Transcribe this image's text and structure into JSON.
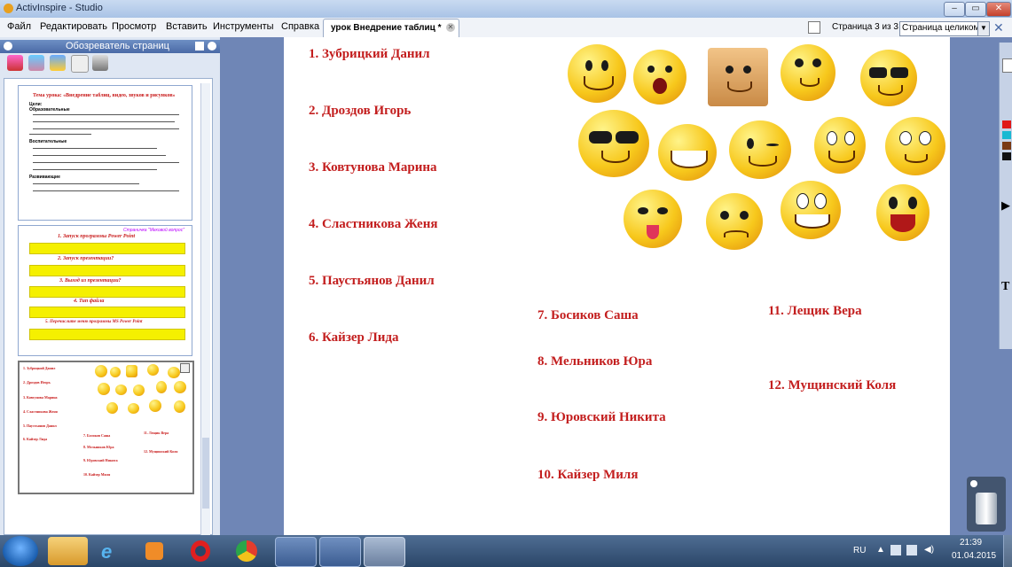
{
  "window": {
    "title": "ActivInspire - Studio"
  },
  "menu": {
    "items": [
      "Файл",
      "Редактировать",
      "Просмотр",
      "Вставить",
      "Инструменты",
      "Справка"
    ]
  },
  "document_tab": {
    "label": "урок Внедрение таблиц *"
  },
  "page_indicator": "Страница 3 из 3",
  "zoom": {
    "selected": "Страница целиком"
  },
  "page_browser": {
    "title": "Обозреватель страниц"
  },
  "thumbnails": {
    "page1": {
      "title": "Тема урока: «Внедрение таблиц, видео, звуков и рисунков»",
      "section1": "Цели:",
      "section2": "Образовательные",
      "section3": "Воспитательные",
      "section4": "Развивающие"
    },
    "page2": {
      "header": "Страничка \"Меховой вопрос\"",
      "q1": "1. Запуск программы Power Point",
      "q2": "2. Запуск презентации?",
      "q3": "3. Выход из презентации?",
      "q4": "4. Тип файла",
      "q5": "5. Перечислите меню программы MS Power Point"
    }
  },
  "students": {
    "s1": "1. Зубрицкий Данил",
    "s2": "2. Дроздов Игорь",
    "s3": "3. Ковтунова Марина",
    "s4": "4. Сластникова Женя",
    "s5": "5. Паустьянов Данил",
    "s6": "6. Кайзер Лида",
    "s7": "7. Босиков Саша",
    "s8": "8. Мельников Юра",
    "s9": "9. Юровский Никита",
    "s10": "10. Кайзер Миля",
    "s11": "11. Лещик Вера",
    "s12": "12. Мущинский Коля"
  },
  "colors": {
    "student_names": "#c31e1e",
    "canvas": "#ffffff",
    "workspace": "#6f86b6"
  },
  "tray": {
    "lang": "RU",
    "time": "21:39",
    "date": "01.04.2015"
  },
  "taskbar": {
    "apps": [
      "start-icon",
      "explorer-icon",
      "ie-icon",
      "media-player-icon",
      "opera-icon",
      "chrome-icon",
      "word-icon",
      "security-icon",
      "activinspire-icon"
    ]
  }
}
